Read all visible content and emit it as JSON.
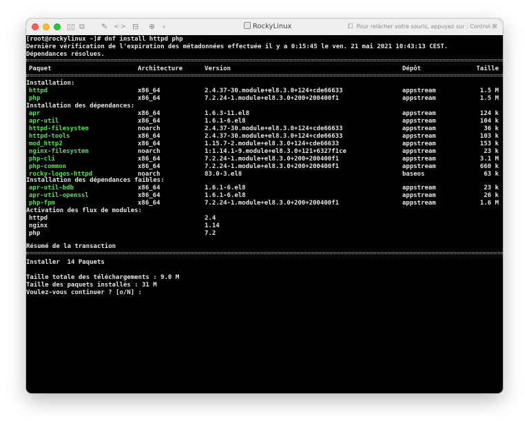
{
  "window": {
    "title": "RockyLinux",
    "hint": "Pour relâcher votre souris, appuyez sur : Control-⌘"
  },
  "toolbar": {
    "icons": [
      "pause-icon",
      "snapshot-icon",
      "wrench-icon",
      "arrows-icon",
      "drive-icon",
      "user-icon",
      "back-icon"
    ]
  },
  "terminal": {
    "lines": {
      "cmd": "[root@rockylinux ~]# dnf install httpd php",
      "meta": "Dernière vérification de l'expiration des métadonnées effectuée il y a 0:15:45 le ven. 21 mai 2021 10:43:13 CEST.",
      "resolved": "Dépendances résolues."
    },
    "headers": {
      "package": "Paquet",
      "arch": "Architecture",
      "version": "Version",
      "repo": "Dépôt",
      "size": "Taille"
    },
    "sections": {
      "install": "Installation:",
      "deps": "Installation des dépendances:",
      "weak": "Installation des dépendances faibles:",
      "modules": "Activation des flux de modules:"
    },
    "install": [
      {
        "name": "httpd",
        "arch": "x86_64",
        "version": "2.4.37-30.module+el8.3.0+124+cde66633",
        "repo": "appstream",
        "size": "1.5 M"
      },
      {
        "name": "php",
        "arch": "x86_64",
        "version": "7.2.24-1.module+el8.3.0+200+200400f1",
        "repo": "appstream",
        "size": "1.5 M"
      }
    ],
    "deps": [
      {
        "name": "apr",
        "arch": "x86_64",
        "version": "1.6.3-11.el8",
        "repo": "appstream",
        "size": "124 k"
      },
      {
        "name": "apr-util",
        "arch": "x86_64",
        "version": "1.6.1-6.el8",
        "repo": "appstream",
        "size": "104 k"
      },
      {
        "name": "httpd-filesystem",
        "arch": "noarch",
        "version": "2.4.37-30.module+el8.3.0+124+cde66633",
        "repo": "appstream",
        "size": "36 k"
      },
      {
        "name": "httpd-tools",
        "arch": "x86_64",
        "version": "2.4.37-30.module+el8.3.0+124+cde66633",
        "repo": "appstream",
        "size": "103 k"
      },
      {
        "name": "mod_http2",
        "arch": "x86_64",
        "version": "1.15.7-2.module+el8.3.0+124+cde66633",
        "repo": "appstream",
        "size": "153 k"
      },
      {
        "name": "nginx-filesystem",
        "arch": "noarch",
        "version": "1:1.14.1-9.module+el8.3.0+121+6327f1ce",
        "repo": "appstream",
        "size": "23 k"
      },
      {
        "name": "php-cli",
        "arch": "x86_64",
        "version": "7.2.24-1.module+el8.3.0+200+200400f1",
        "repo": "appstream",
        "size": "3.1 M"
      },
      {
        "name": "php-common",
        "arch": "x86_64",
        "version": "7.2.24-1.module+el8.3.0+200+200400f1",
        "repo": "appstream",
        "size": "660 k"
      },
      {
        "name": "rocky-logos-httpd",
        "arch": "noarch",
        "version": "83.0-3.el8",
        "repo": "baseos",
        "size": "63 k"
      }
    ],
    "weak": [
      {
        "name": "apr-util-bdb",
        "arch": "x86_64",
        "version": "1.6.1-6.el8",
        "repo": "appstream",
        "size": "23 k"
      },
      {
        "name": "apr-util-openssl",
        "arch": "x86_64",
        "version": "1.6.1-6.el8",
        "repo": "appstream",
        "size": "26 k"
      },
      {
        "name": "php-fpm",
        "arch": "x86_64",
        "version": "7.2.24-1.module+el8.3.0+200+200400f1",
        "repo": "appstream",
        "size": "1.6 M"
      }
    ],
    "modules": [
      {
        "name": "httpd",
        "version": "2.4"
      },
      {
        "name": "nginx",
        "version": "1.14"
      },
      {
        "name": "php",
        "version": "7.2"
      }
    ],
    "summary": {
      "title": "Résumé de la transaction",
      "install": "Installer  14 Paquets",
      "download": "Taille totale des téléchargements : 9.0 M",
      "installed": "Taille des paquets installés : 31 M",
      "prompt": "Voulez-vous continuer ? [o/N] :"
    }
  }
}
